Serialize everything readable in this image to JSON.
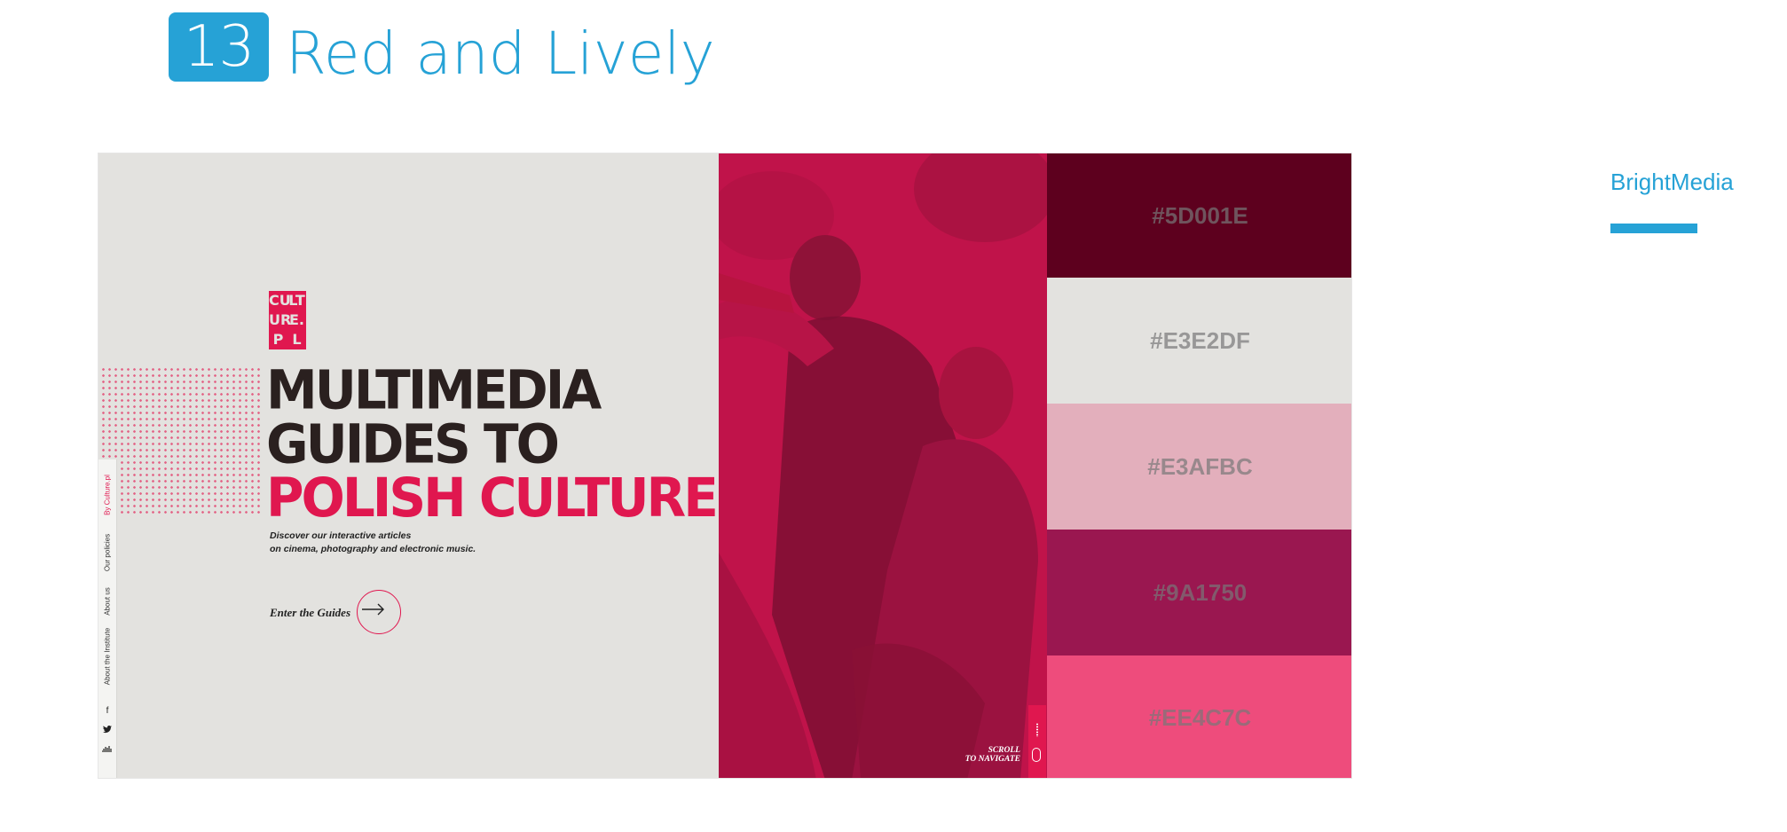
{
  "heading": {
    "number": "13",
    "title": "Red and Lively"
  },
  "brand": {
    "name": "BrightMedia"
  },
  "site": {
    "logo_letters": [
      "CU",
      "LT",
      "UR",
      "E.",
      "P",
      "L"
    ],
    "headline": {
      "line1": "MULTIMEDIA",
      "line2": "GUIDES TO",
      "line3": "POLISH CULTURE"
    },
    "subtext": {
      "line1": "Discover our interactive articles",
      "line2": "on cinema, photography and electronic music."
    },
    "cta": {
      "label": "Enter the Guides"
    },
    "sidebar": {
      "links": [
        "By Culture.pl",
        "Our policies",
        "About us",
        "About the Institute"
      ],
      "icons": [
        "facebook-icon",
        "twitter-icon",
        "soundcloud-icon"
      ]
    },
    "scroll": {
      "line1": "SCROLL",
      "line2": "TO NAVIGATE"
    }
  },
  "palette": [
    {
      "label": "#5D001E",
      "color": "#5D001E"
    },
    {
      "label": "#E3E2DF",
      "color": "#E3E2DF"
    },
    {
      "label": "#E3AFBC",
      "color": "#E3AFBC"
    },
    {
      "label": "#9A1750",
      "color": "#9A1750"
    },
    {
      "label": "#EE4C7C",
      "color": "#EE4C7C"
    }
  ]
}
